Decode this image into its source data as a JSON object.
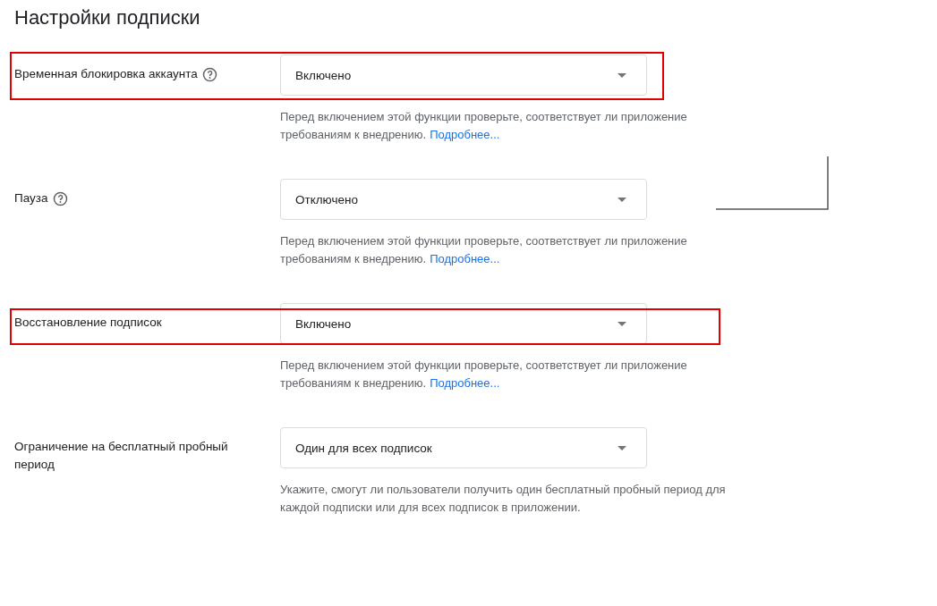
{
  "title": "Настройки подписки",
  "settings": [
    {
      "label": "Временная блокировка аккаунта",
      "help_icon": true,
      "value": "Включено",
      "hint": "Перед включением этой функции проверьте, соответствует ли приложение требованиям к внедрению.",
      "link": "Подробнее...",
      "highlighted": true,
      "wide_highlight": false
    },
    {
      "label": "Пауза",
      "help_icon": true,
      "value": "Отключено",
      "hint": "Перед включением этой функции проверьте, соответствует ли приложение требованиям к внедрению.",
      "link": "Подробнее...",
      "highlighted": false
    },
    {
      "label": "Восстановление подписок",
      "help_icon": false,
      "value": "Включено",
      "hint": "Перед включением этой функции проверьте, соответствует ли приложение требованиям к внедрению.",
      "link": "Подробнее...",
      "highlighted": true,
      "wide_highlight": true
    },
    {
      "label": "Ограничение на бесплатный пробный период",
      "help_icon": false,
      "value": "Один для всех подписок",
      "hint": "Укажите, смогут ли пользователи получить один бесплатный пробный период для каждой подписки или для всех подписок в приложении.",
      "highlighted": false
    }
  ]
}
